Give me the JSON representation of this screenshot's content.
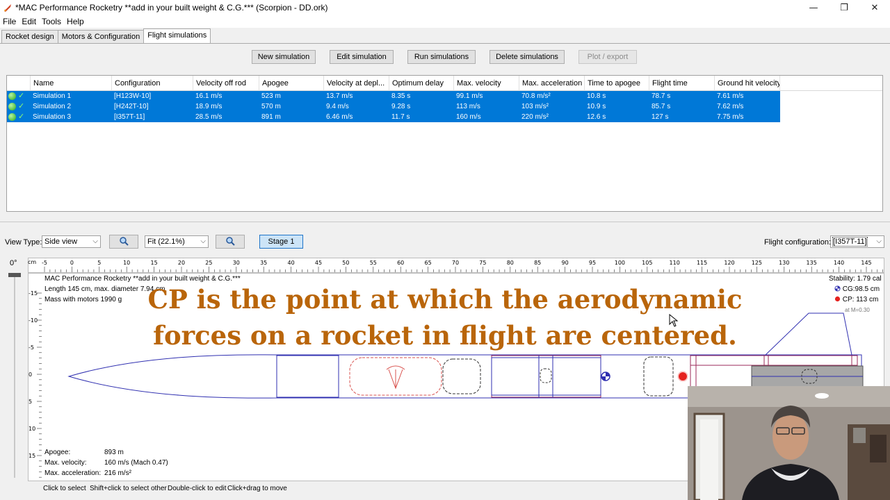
{
  "window": {
    "title": "*MAC Performance Rocketry **add in your built weight & C.G.*** (Scorpion - DD.ork)",
    "controls": {
      "minimize": "—",
      "maximize": "❐",
      "close": "✕"
    }
  },
  "menu": {
    "items": [
      "File",
      "Edit",
      "Tools",
      "Help"
    ]
  },
  "tabs": [
    {
      "label": "Rocket design",
      "active": false
    },
    {
      "label": "Motors & Configuration",
      "active": false
    },
    {
      "label": "Flight simulations",
      "active": true
    }
  ],
  "toolbar": {
    "new_simulation": "New simulation",
    "edit_simulation": "Edit simulation",
    "run_simulations": "Run simulations",
    "delete_simulations": "Delete simulations",
    "plot_export": "Plot / export"
  },
  "table": {
    "columns": [
      "Name",
      "Configuration",
      "Velocity off rod",
      "Apogee",
      "Velocity at depl...",
      "Optimum delay",
      "Max. velocity",
      "Max. acceleration",
      "Time to apogee",
      "Flight time",
      "Ground hit velocity"
    ],
    "rows": [
      [
        "Simulation 1",
        "[H123W-10]",
        "16.1 m/s",
        "523 m",
        "13.7 m/s",
        "8.35 s",
        "99.1 m/s",
        "70.8 m/s²",
        "10.8 s",
        "78.7 s",
        "7.61 m/s"
      ],
      [
        "Simulation 2",
        "[H242T-10]",
        "18.9 m/s",
        "570 m",
        "9.4 m/s",
        "9.28 s",
        "113 m/s",
        "103 m/s²",
        "10.9 s",
        "85.7 s",
        "7.62 m/s"
      ],
      [
        "Simulation 3",
        "[I357T-11]",
        "28.5 m/s",
        "891 m",
        "6.46 m/s",
        "11.7 s",
        "160 m/s",
        "220 m/s²",
        "12.6 s",
        "127 s",
        "7.75 m/s"
      ]
    ]
  },
  "view": {
    "view_type_label": "View Type:",
    "view_type_value": "Side view",
    "zoom_value": "Fit (22.1%)",
    "stage_button": "Stage 1",
    "flight_config_label": "Flight configuration:",
    "flight_config_value": "[I357T-11]",
    "angle_label": "0°",
    "ruler_unit": "cm",
    "ruler_top_ticks": [
      "-5",
      "0",
      "5",
      "10",
      "15",
      "20",
      "25",
      "30",
      "35",
      "40",
      "45",
      "50",
      "55",
      "60",
      "65",
      "70",
      "75",
      "80",
      "85",
      "90",
      "95",
      "100",
      "105",
      "110",
      "115",
      "120",
      "125",
      "130",
      "135",
      "140",
      "145"
    ],
    "ruler_left_ticks": [
      "-15",
      "-10",
      "-5",
      "0",
      "5",
      "10",
      "15"
    ]
  },
  "rocket_info": {
    "name": "MAC Performance Rocketry **add in your built weight & C.G.***",
    "length": "Length 145 cm, max. diameter 7.94 cm",
    "mass": "Mass with motors 1990 g",
    "stability": "Stability: 1.79 cal",
    "cg": "CG:98.5 cm",
    "cp": "CP: 113 cm",
    "mach": "at M=0.30"
  },
  "flight_summary": {
    "apogee_label": "Apogee:",
    "apogee_value": "893 m",
    "max_velocity_label": "Max. velocity:",
    "max_velocity_value": "160 m/s  (Mach 0.47)",
    "max_acceleration_label": "Max. acceleration:",
    "max_acceleration_value": "216 m/s²"
  },
  "overlay_caption": {
    "line1": "CP is the point at which the aerodynamic",
    "line2": "forces on a rocket in flight are centered."
  },
  "status_hints": [
    "Click to select",
    "Shift+click to select other",
    "Double-click to edit",
    "Click+drag to move"
  ],
  "colors": {
    "selection": "#0078d7",
    "caption": "#b9650a",
    "rocket_body": "#2f2fb0",
    "parachute": "#d9534f",
    "fins": "#9b2a5a",
    "motor_fill": "#a7a7a7",
    "cp_marker": "#e5221f"
  }
}
